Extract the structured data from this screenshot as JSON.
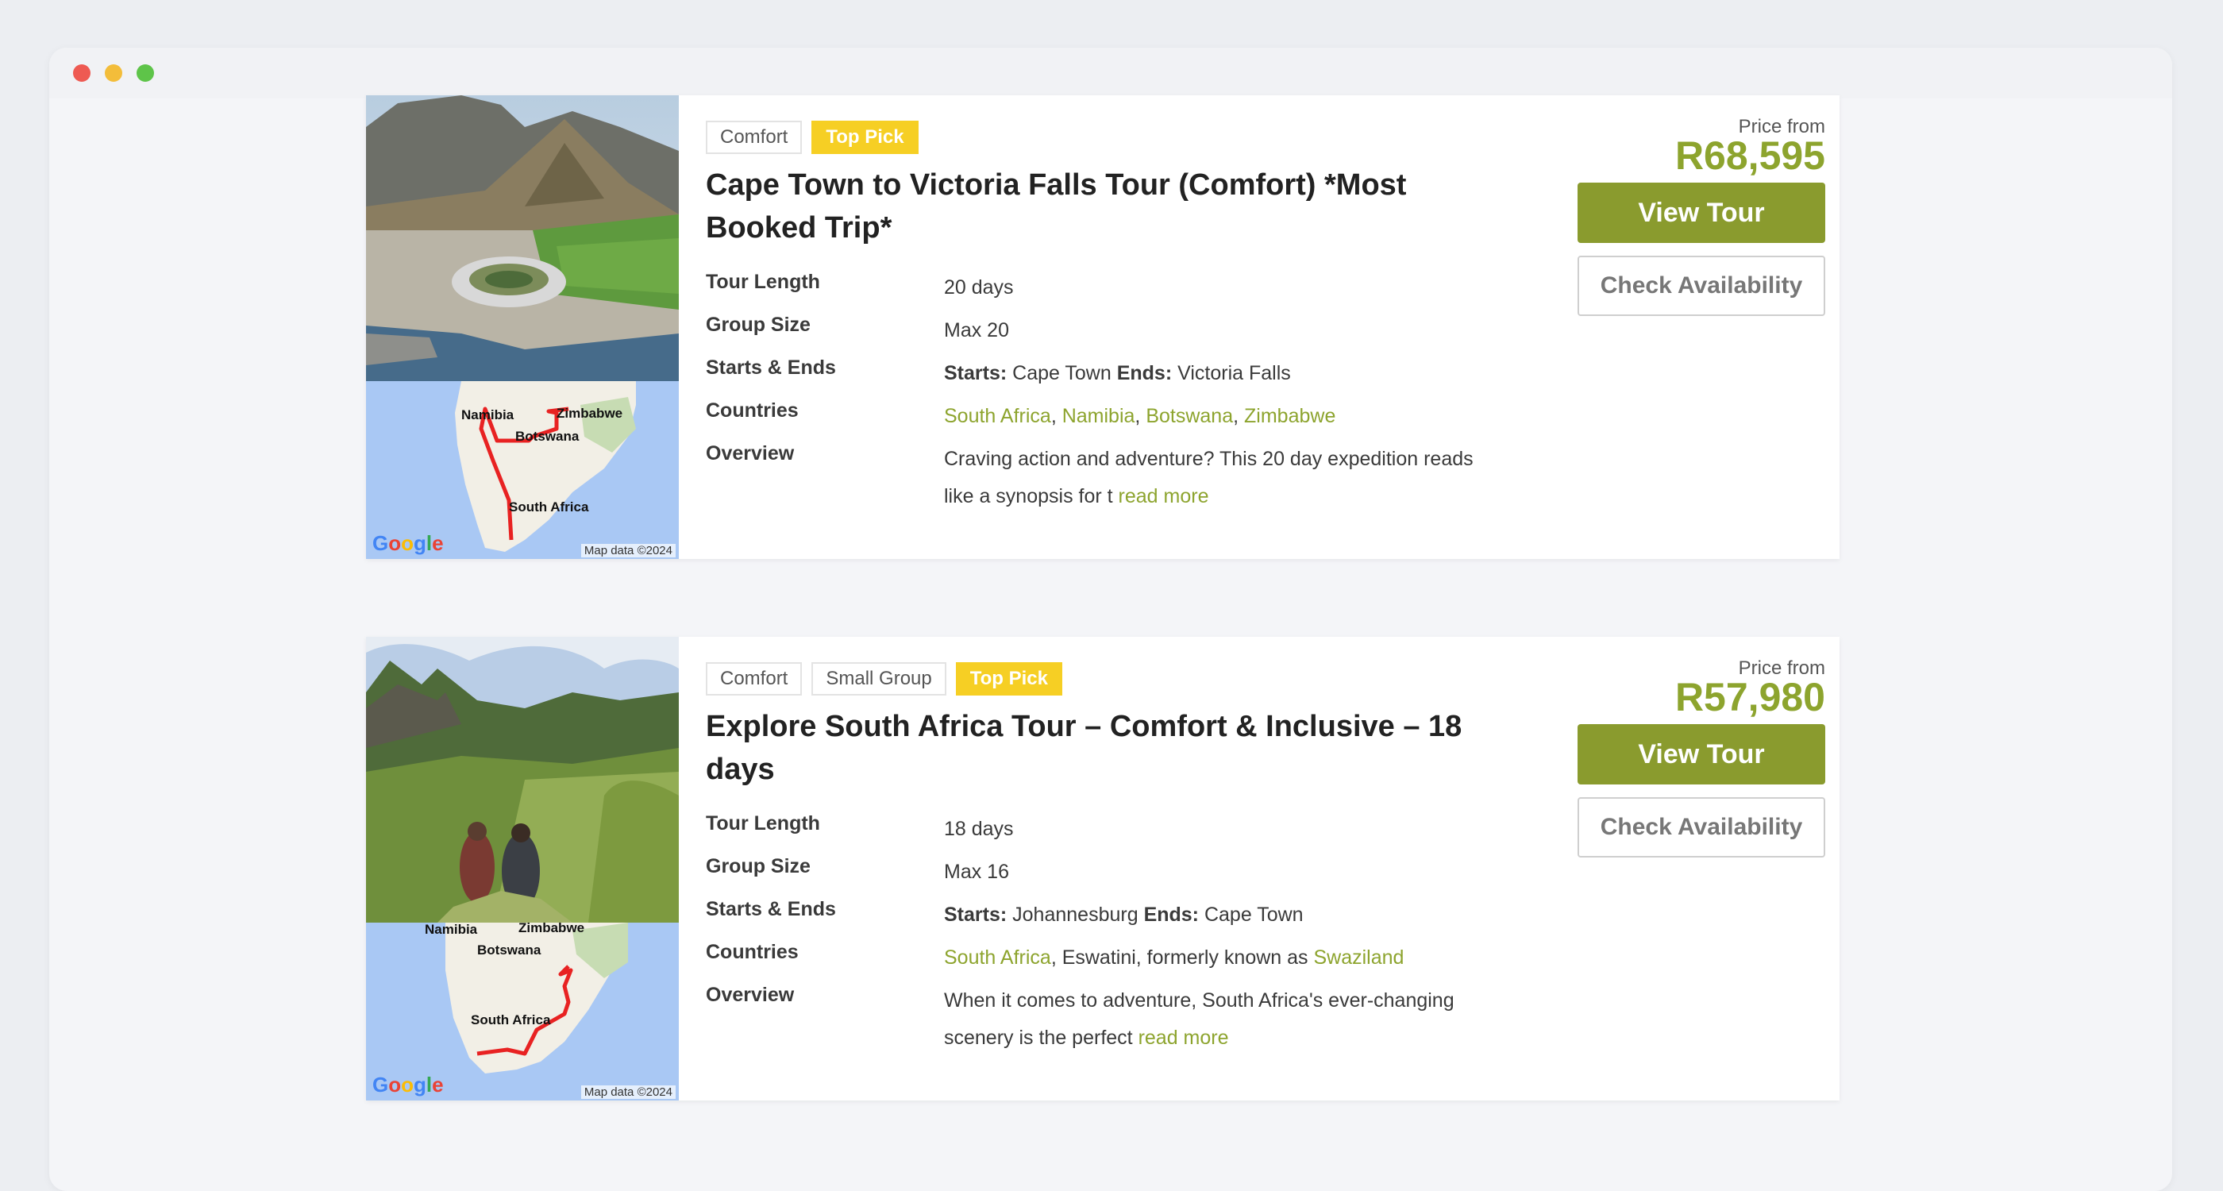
{
  "window": {
    "controls": [
      "close",
      "minimize",
      "maximize"
    ]
  },
  "colors": {
    "accent": "#8a9b2e",
    "top_pick": "#f6cf24"
  },
  "tours": [
    {
      "tags": [
        "Comfort",
        "Top Pick"
      ],
      "title": "Cape Town to Victoria Falls Tour (Comfort) *Most Booked Trip*",
      "labels": {
        "length": "Tour Length",
        "group": "Group Size",
        "starts_ends": "Starts & Ends",
        "countries": "Countries",
        "overview": "Overview"
      },
      "tour_length": "20 days",
      "group_size": "Max 20",
      "starts_label": "Starts:",
      "starts": "Cape Town",
      "ends_label": "Ends:",
      "ends": "Victoria Falls",
      "countries": [
        "South Africa",
        "Namibia",
        "Botswana",
        "Zimbabwe"
      ],
      "overview": "Craving action and adventure? This 20 day expedition reads like a synopsis for t",
      "read_more": "read more",
      "price_from": "Price from",
      "price": "R68,595",
      "view_button": "View Tour",
      "check_button": "Check Availability",
      "map_labels": [
        "Namibia",
        "Zimbabwe",
        "Botswana",
        "South Africa"
      ],
      "map_credit": "Map data ©2024"
    },
    {
      "tags": [
        "Comfort",
        "Small Group",
        "Top Pick"
      ],
      "title": "Explore South Africa Tour – Comfort & Inclusive – 18 days",
      "labels": {
        "length": "Tour Length",
        "group": "Group Size",
        "starts_ends": "Starts & Ends",
        "countries": "Countries",
        "overview": "Overview"
      },
      "tour_length": "18 days",
      "group_size": "Max 16",
      "starts_label": "Starts:",
      "starts": "Johannesburg",
      "ends_label": "Ends:",
      "ends": "Cape Town",
      "countries_link1": "South Africa",
      "countries_text": ", Eswatini, formerly known as ",
      "countries_link2": "Swaziland",
      "overview": "When it comes to adventure, South Africa's ever-changing scenery is the perfect",
      "read_more": "read more",
      "price_from": "Price from",
      "price": "R57,980",
      "view_button": "View Tour",
      "check_button": "Check Availability",
      "map_labels": [
        "Namibia",
        "Zimbabwe",
        "Botswana",
        "South Africa"
      ],
      "map_credit": "Map data ©2024"
    }
  ]
}
